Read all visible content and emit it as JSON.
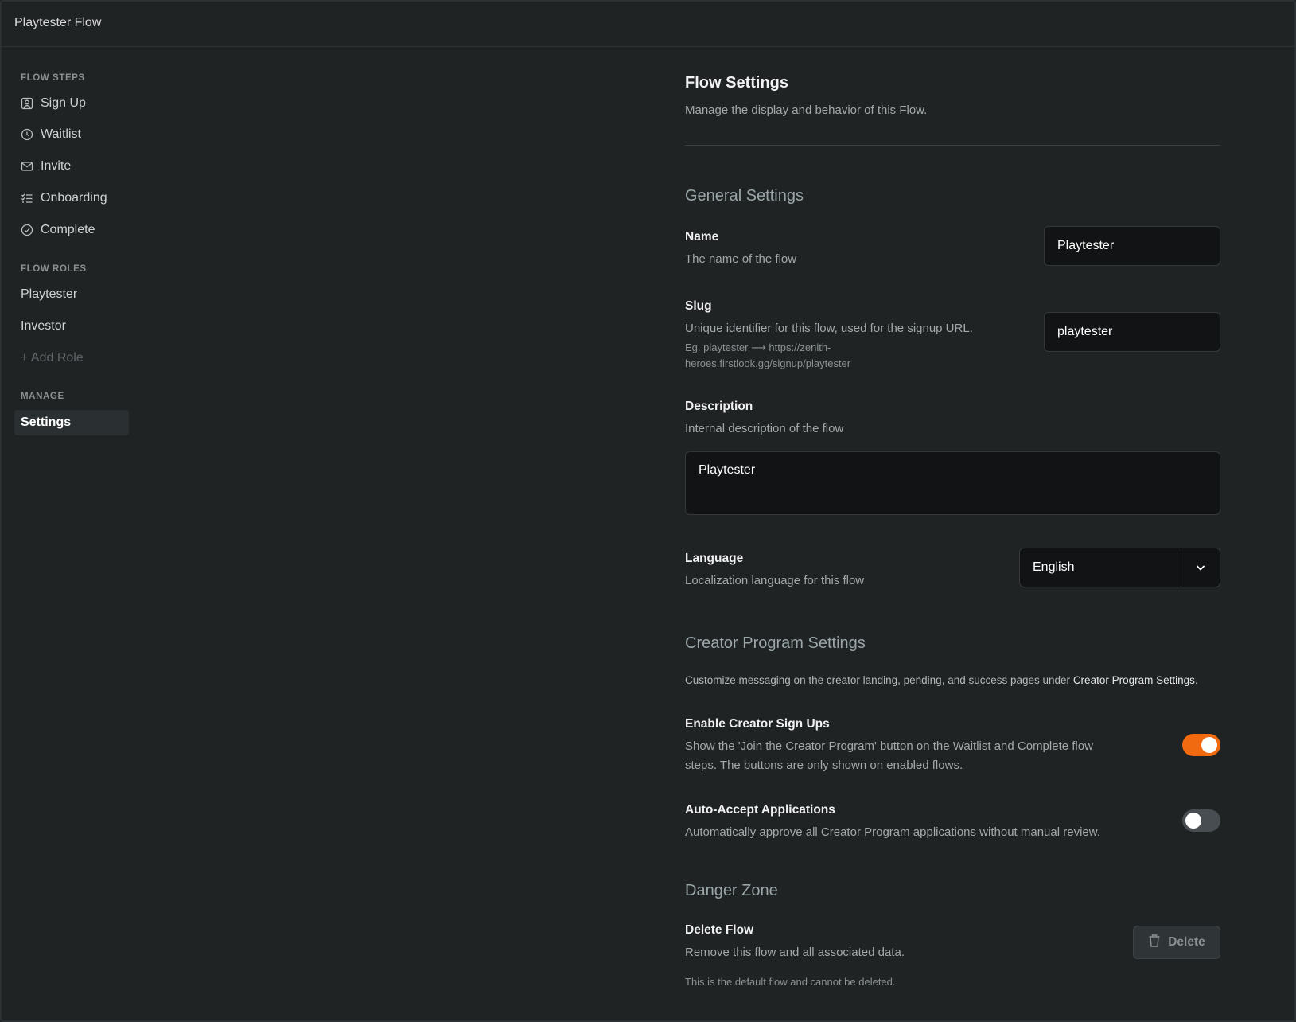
{
  "app": {
    "title": "Playtester Flow"
  },
  "sidebar": {
    "flow_steps_label": "FLOW STEPS",
    "steps": [
      {
        "label": "Sign Up",
        "icon": "user-square-icon"
      },
      {
        "label": "Waitlist",
        "icon": "clock-icon"
      },
      {
        "label": "Invite",
        "icon": "mail-icon"
      },
      {
        "label": "Onboarding",
        "icon": "checklist-icon"
      },
      {
        "label": "Complete",
        "icon": "check-circle-icon"
      }
    ],
    "flow_roles_label": "FLOW ROLES",
    "roles": [
      {
        "label": "Playtester"
      },
      {
        "label": "Investor"
      }
    ],
    "add_role": "+ Add Role",
    "manage_label": "MANAGE",
    "manage_items": [
      {
        "label": "Settings",
        "active": true
      }
    ]
  },
  "main": {
    "title": "Flow Settings",
    "subtitle": "Manage the display and behavior of this Flow.",
    "general": {
      "title": "General Settings",
      "name": {
        "label": "Name",
        "desc": "The name of the flow",
        "value": "Playtester"
      },
      "slug": {
        "label": "Slug",
        "desc": "Unique identifier for this flow, used for the signup URL.",
        "example_line1": "Eg. playtester ⟶ https://zenith-",
        "example_line2": "heroes.firstlook.gg/signup/playtester",
        "value": "playtester"
      },
      "description": {
        "label": "Description",
        "desc": "Internal description of the flow",
        "value": "Playtester"
      },
      "language": {
        "label": "Language",
        "desc": "Localization language for this flow",
        "value": "English"
      }
    },
    "creator": {
      "title": "Creator Program Settings",
      "intro": "Customize messaging on the creator landing, pending, and success pages under ",
      "intro_link": "Creator Program Settings",
      "intro_end": ".",
      "enable": {
        "label": "Enable Creator Sign Ups",
        "desc_line1": "Show the 'Join the Creator Program' button on the Waitlist and Complete flow",
        "desc_line2": "steps. The buttons are only shown on enabled flows.",
        "on": true
      },
      "auto_accept": {
        "label": "Auto-Accept Applications",
        "desc": "Automatically approve all Creator Program applications without manual review.",
        "on": false
      }
    },
    "danger": {
      "title": "Danger Zone",
      "delete": {
        "label": "Delete Flow",
        "desc": "Remove this flow and all associated data.",
        "note": "This is the default flow and cannot be deleted.",
        "button": "Delete"
      }
    }
  },
  "colors": {
    "background": "#1f2324",
    "accent": "#f26a10",
    "section_title": "#9aa6a8"
  }
}
